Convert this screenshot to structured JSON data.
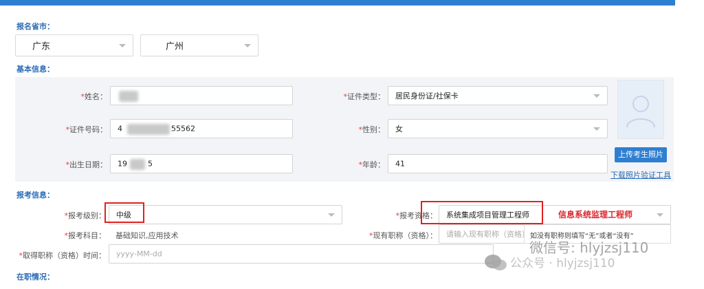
{
  "sections": {
    "province_city": "报名省市：",
    "basic_info": "基本信息：",
    "exam_info": "报考信息：",
    "employment": "在职情况："
  },
  "province": {
    "selected": "广东"
  },
  "city": {
    "selected": "广州"
  },
  "basic": {
    "name": {
      "label": "姓名：",
      "value": ""
    },
    "id_type": {
      "label": "证件类型：",
      "value": "居民身份证/社保卡"
    },
    "id_number": {
      "label": "证件号码：",
      "prefix": "4",
      "suffix": "55562"
    },
    "gender": {
      "label": "性别：",
      "value": "女"
    },
    "birth_date": {
      "label": "出生日期：",
      "prefix": "19",
      "suffix": "5"
    },
    "age": {
      "label": "年龄：",
      "value": "41"
    }
  },
  "photo": {
    "upload_label": "上传考生照片",
    "download_link": "下载照片验证工具"
  },
  "exam": {
    "level": {
      "label": "报考级别：",
      "value": "中级"
    },
    "qualification": {
      "label": "报考资格：",
      "value": "系统集成项目管理工程师"
    },
    "subjects": {
      "label": "报考科目：",
      "value": "基础知识,应用技术"
    },
    "current_title": {
      "label": "现有职称（资格）：",
      "placeholder": "请输入现有职称（资格）"
    },
    "title_date": {
      "label": "取得职称（资格）时间：",
      "placeholder": "yyyy-MM-dd"
    }
  },
  "annotation": {
    "text": "信息系统监理工程师"
  },
  "tooltip": {
    "text": "如没有职称则填写“无”或者“没有”"
  },
  "watermark": {
    "line1": "微信号: hlyjzsj110",
    "line2": "公众号 · hlyjzsj110"
  },
  "colors": {
    "accent": "#2f7fd1",
    "required": "#e03c3c",
    "highlight": "#e02020"
  }
}
